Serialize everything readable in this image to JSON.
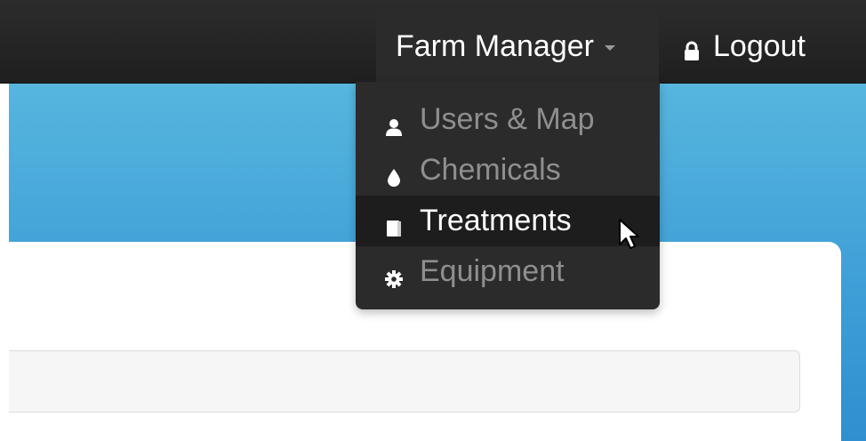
{
  "navbar": {
    "dropdown_toggle_label": "Farm Manager",
    "logout_label": "Logout"
  },
  "dropdown": {
    "items": [
      {
        "label": "Users & Map",
        "icon": "user-icon",
        "state": "normal"
      },
      {
        "label": "Chemicals",
        "icon": "droplet-icon",
        "state": "normal"
      },
      {
        "label": "Treatments",
        "icon": "book-icon",
        "state": "hover"
      },
      {
        "label": "Equipment",
        "icon": "gear-icon",
        "state": "normal"
      }
    ]
  },
  "colors": {
    "navbar_bg": "#222222",
    "dropdown_bg": "#2b2b2b",
    "hero_blue": "#3f9fd7",
    "item_text_muted": "#8f8f8f",
    "item_text_active": "#ffffff"
  }
}
